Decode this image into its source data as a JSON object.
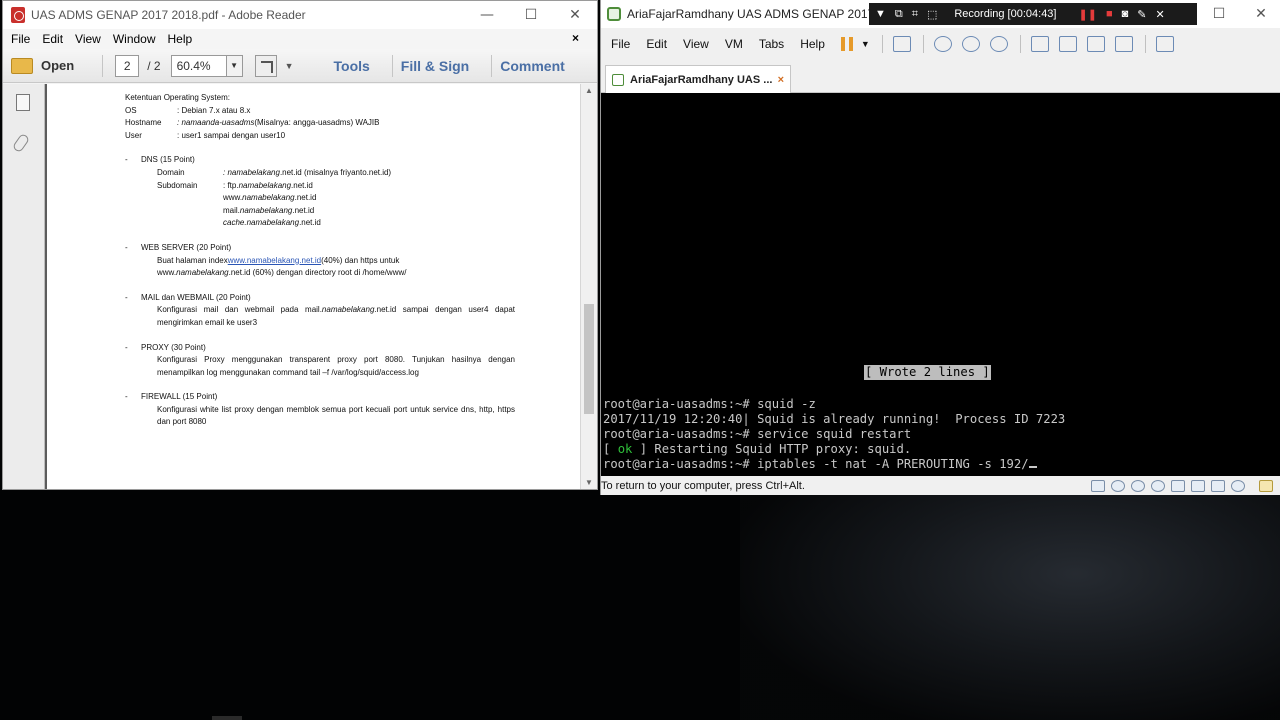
{
  "reader": {
    "title": "UAS ADMS GENAP 2017 2018.pdf - Adobe Reader",
    "menu": [
      "File",
      "Edit",
      "View",
      "Window",
      "Help"
    ],
    "menu_close": "×",
    "toolbar": {
      "open_label": "Open",
      "page_current": "2",
      "page_total": "/ 2",
      "zoom": "60.4%",
      "tools_label": "Tools",
      "fill_sign_label": "Fill & Sign",
      "comment_label": "Comment"
    },
    "doc": {
      "os_heading": "Ketentuan Operating System:",
      "os_rows": [
        {
          "key": "OS",
          "value": ": Debian 7.x atau 8.x"
        },
        {
          "key": "Hostname",
          "value_italic": ": namaanda-uasadms",
          "value": " (Misalnya: angga-uasadms) WAJIB"
        },
        {
          "key": "User",
          "value": ": user1 sampai dengan user10"
        }
      ],
      "dns_heading": "DNS (15 Point)",
      "dns_domain_key": "Domain",
      "dns_domain_value_italic": ": namabelakang",
      "dns_domain_value": ".net.id (misalnya friyanto.net.id)",
      "dns_subdomain_key": "Subdomain",
      "dns_subdomains": [
        {
          "pre": ": ftp.",
          "it": "namabelakang",
          "post": ".net.id"
        },
        {
          "pre": "www.",
          "it": "namabelakang",
          "post": ".net.id"
        },
        {
          "pre": "mail.",
          "it": "namabelakang",
          "post": ".net.id"
        },
        {
          "pre": "",
          "it": "cache.namabelakang",
          "post": ".net.id"
        }
      ],
      "web_heading": "WEB SERVER (20 Point)",
      "web_line1_pre": "Buat halaman index ",
      "web_line1_link": "www.namabelakang.net.id",
      "web_line1_post": " (40%) dan https untuk",
      "web_line2_pre": "www.",
      "web_line2_it": "namabelakang",
      "web_line2_post": ".net.id (60%) dengan directory root di /home/www/",
      "mail_heading": "MAIL dan WEBMAIL (20 Point)",
      "mail_body_pre": "Konfigurasi mail dan webmail pada mail.",
      "mail_body_it": "namabelakang",
      "mail_body_post": ".net.id sampai dengan user4 dapat mengirimkan email ke user3",
      "proxy_heading": "PROXY (30 Point)",
      "proxy_body": "Konfigurasi Proxy menggunakan transparent proxy port 8080. Tunjukan hasilnya dengan menampilkan log menggunakan command tail –f /var/log/squid/access.log",
      "fw_heading": "FIREWALL (15 Point)",
      "fw_body": "Konfigurasi white list proxy dengan memblok semua port kecuali port untuk service dns, http, https dan port 8080",
      "bullet": "-"
    }
  },
  "vmware": {
    "title": "AriaFajarRamdhany UAS ADMS GENAP 2017 2018",
    "recording": "Recording [00:04:43]",
    "menu": [
      "File",
      "Edit",
      "View",
      "VM",
      "Tabs",
      "Help"
    ],
    "tab_label": "AriaFajarRamdhany UAS ...",
    "tab_close": "×",
    "wrote": "[ Wrote 2 lines ]",
    "terminal": [
      "root@aria-uasadms:~# squid -z",
      "2017/11/19 12:20:40| Squid is already running!  Process ID 7223",
      "root@aria-uasadms:~# service squid restart"
    ],
    "ok_prefix": "[ ",
    "ok_word": "ok",
    "ok_rest": " ] Restarting Squid HTTP proxy: squid.",
    "prompt_line": "root@aria-uasadms:~# iptables -t nat -A PREROUTING -s 192/",
    "status_text": "To return to your computer, press Ctrl+Alt."
  }
}
